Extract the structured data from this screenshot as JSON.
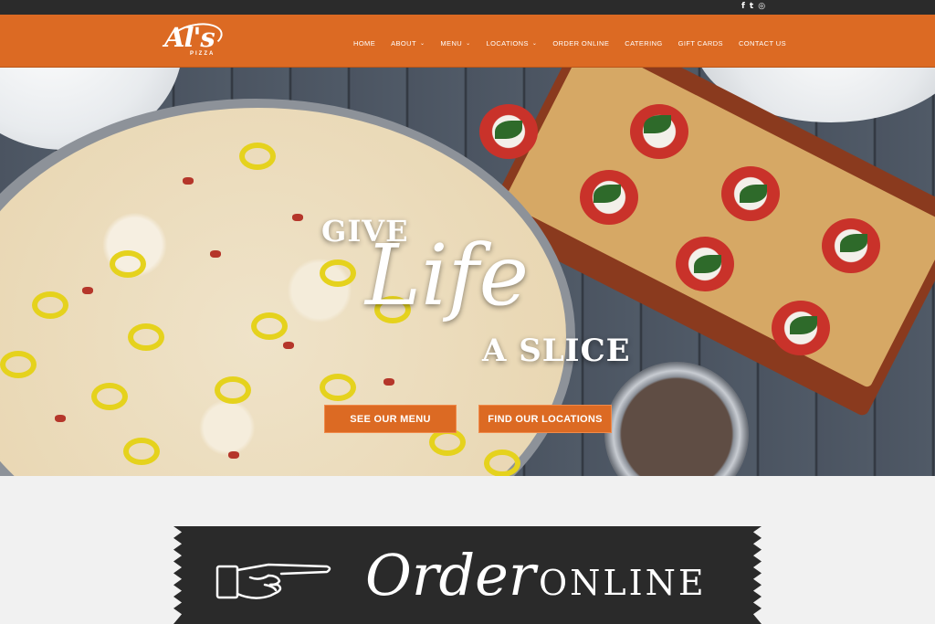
{
  "social": {
    "facebook": "f",
    "twitter": "t",
    "instagram": "◎"
  },
  "logo": {
    "script": "Al's",
    "sub": "PIZZA"
  },
  "nav": {
    "home": "HOME",
    "about": "ABOUT",
    "menu": "MENU",
    "locations": "LOCATIONS",
    "order_online": "ORDER ONLINE",
    "catering": "CATERING",
    "gift_cards": "GIFT CARDS",
    "contact_us": "CONTACT US",
    "dropdown_glyph": "⌄"
  },
  "hero": {
    "line1": "GIVE",
    "line2": "Life",
    "line3": "A SLICE",
    "cta_menu": "SEE OUR MENU",
    "cta_locations": "FIND OUR LOCATIONS"
  },
  "order_banner": {
    "script": "Order",
    "caps": "ONLINE"
  },
  "colors": {
    "brand_orange": "#dc6a23",
    "topbar": "#2b2b2b",
    "banner_dark": "#2a2a2a"
  }
}
